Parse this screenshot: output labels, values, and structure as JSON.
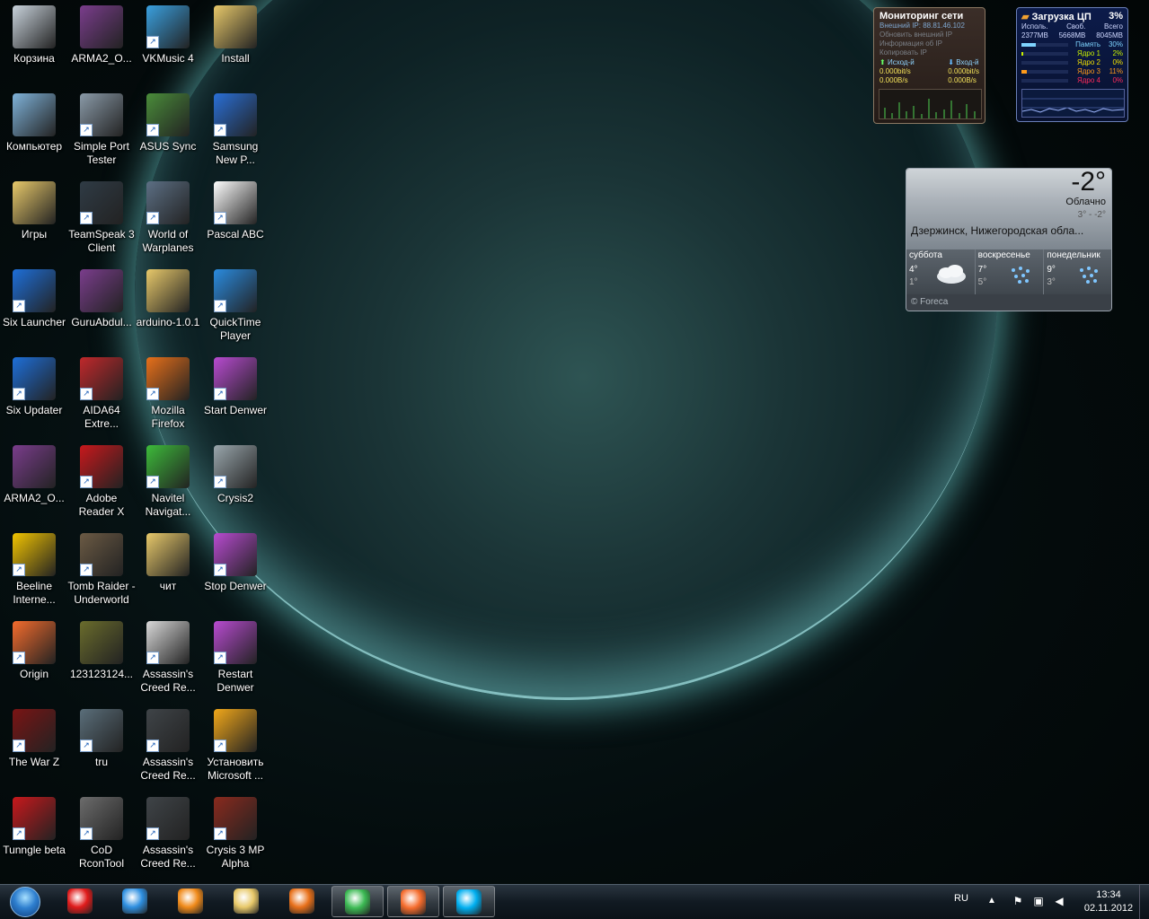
{
  "desktop": {
    "icons": [
      {
        "label": "Корзина",
        "icon": "recycle-bin-icon",
        "color": "#c9d3dc",
        "shortcut": false
      },
      {
        "label": "ARMA2_O...",
        "icon": "winrar-icon",
        "color": "#7a3d8c",
        "shortcut": false
      },
      {
        "label": "VKMusic 4",
        "icon": "vkmusic-icon",
        "color": "#3aa0e0",
        "shortcut": true
      },
      {
        "label": "Install",
        "icon": "folder-icon",
        "color": "#e8c96a",
        "shortcut": false
      },
      {
        "label": "Компьютер",
        "icon": "computer-icon",
        "color": "#7fb2d9",
        "shortcut": false
      },
      {
        "label": "Simple Port Tester",
        "icon": "port-tester-icon",
        "color": "#8a9aa8",
        "shortcut": true
      },
      {
        "label": "ASUS Sync",
        "icon": "asus-sync-icon",
        "color": "#4a8c3a",
        "shortcut": true
      },
      {
        "label": "Samsung New P...",
        "icon": "nps-icon",
        "color": "#2a6fd6",
        "shortcut": true
      },
      {
        "label": "Игры",
        "icon": "folder-icon",
        "color": "#e8c96a",
        "shortcut": false
      },
      {
        "label": "TeamSpeak 3 Client",
        "icon": "teamspeak-icon",
        "color": "#2f3b45",
        "shortcut": true
      },
      {
        "label": "World of Warplanes",
        "icon": "warplanes-icon",
        "color": "#5c6f84",
        "shortcut": true
      },
      {
        "label": "Pascal ABC",
        "icon": "pascal-abc-icon",
        "color": "#ffffff",
        "shortcut": true
      },
      {
        "label": "Six Launcher",
        "icon": "six-launcher-icon",
        "color": "#1e6fd9",
        "shortcut": true
      },
      {
        "label": "GuruAbdul...",
        "icon": "winrar-icon",
        "color": "#7a3d8c",
        "shortcut": false
      },
      {
        "label": "arduino-1.0.1",
        "icon": "folder-icon",
        "color": "#e8c96a",
        "shortcut": false
      },
      {
        "label": "QuickTime Player",
        "icon": "quicktime-icon",
        "color": "#2a8be0",
        "shortcut": true
      },
      {
        "label": "Six Updater",
        "icon": "six-updater-icon",
        "color": "#1e6fd9",
        "shortcut": true
      },
      {
        "label": "AIDA64 Extre...",
        "icon": "aida64-icon",
        "color": "#c0282b",
        "shortcut": true
      },
      {
        "label": "Mozilla Firefox",
        "icon": "firefox-icon",
        "color": "#e8701a",
        "shortcut": true
      },
      {
        "label": "Start Denwer",
        "icon": "denwer-start-icon",
        "color": "#b84bd1",
        "shortcut": true
      },
      {
        "label": "ARMA2_O...",
        "icon": "winrar-icon",
        "color": "#7a3d8c",
        "shortcut": false
      },
      {
        "label": "Adobe Reader X",
        "icon": "adobe-reader-icon",
        "color": "#c8181c",
        "shortcut": true
      },
      {
        "label": "Navitel Navigat...",
        "icon": "navitel-icon",
        "color": "#3dbb3a",
        "shortcut": true
      },
      {
        "label": "Crysis2",
        "icon": "crysis2-icon",
        "color": "#9aa7ad",
        "shortcut": true
      },
      {
        "label": "Beeline Interne...",
        "icon": "beeline-icon",
        "color": "#f2c400",
        "shortcut": true
      },
      {
        "label": "Tomb Raider - Underworld",
        "icon": "tomb-raider-icon",
        "color": "#6b5a44",
        "shortcut": true
      },
      {
        "label": "чит",
        "icon": "folder-icon",
        "color": "#e8c96a",
        "shortcut": false
      },
      {
        "label": "Stop Denwer",
        "icon": "denwer-stop-icon",
        "color": "#b84bd1",
        "shortcut": true
      },
      {
        "label": "Origin",
        "icon": "origin-icon",
        "color": "#f56c2d",
        "shortcut": true
      },
      {
        "label": "123123124...",
        "icon": "image-file-icon",
        "color": "#6a6c2c",
        "shortcut": false
      },
      {
        "label": "Assassin's Creed Re...",
        "icon": "assassins-creed-icon",
        "color": "#d9d9d9",
        "shortcut": true
      },
      {
        "label": "Restart Denwer",
        "icon": "denwer-restart-icon",
        "color": "#b84bd1",
        "shortcut": true
      },
      {
        "label": "The War Z",
        "icon": "warz-icon",
        "color": "#7a1414",
        "shortcut": true
      },
      {
        "label": "tru",
        "icon": "tomb-raider-icon",
        "color": "#5a6e7a",
        "shortcut": true
      },
      {
        "label": "Assassin's Creed Re...",
        "icon": "assassins-creed-icon",
        "color": "#3f4448",
        "shortcut": true
      },
      {
        "label": "Установить Microsoft ...",
        "icon": "ms-install-icon",
        "color": "#f2a81a",
        "shortcut": true
      },
      {
        "label": "Tunngle beta",
        "icon": "tunngle-icon",
        "color": "#c8181c",
        "shortcut": true
      },
      {
        "label": "CoD RconTool",
        "icon": "cod-rcon-icon",
        "color": "#6c6c6c",
        "shortcut": true
      },
      {
        "label": "Assassin's Creed Re...",
        "icon": "assassins-creed-icon",
        "color": "#3f4448",
        "shortcut": true
      },
      {
        "label": "Crysis 3 MP Alpha",
        "icon": "crysis3-icon",
        "color": "#8a2a1e",
        "shortcut": true
      }
    ]
  },
  "net_gadget": {
    "title": "Мониторинг сети",
    "ip_line": "Внешний IP: 88.81.46.102",
    "refresh": "Обновить внешний IP",
    "info": "Информация об IP",
    "copy": "Копировать IP",
    "out_label": "Исход-й",
    "in_label": "Вход-й",
    "out_bits": "0.000bit/s",
    "out_bytes": "0.000B/s",
    "in_bits": "0.000bit/s",
    "in_bytes": "0.000B/s"
  },
  "cpu_gadget": {
    "title": "Загрузка ЦП",
    "percent": "3%",
    "used_label": "Исполь.",
    "free_label": "Своб.",
    "total_label": "Всего",
    "used": "2377MB",
    "free": "5668MB",
    "total": "8045MB",
    "rows": [
      {
        "name": "Память",
        "value": "30%",
        "color": "#7fd4ff",
        "fill": 0.3
      },
      {
        "name": "Ядро 1",
        "value": "2%",
        "color": "#c8f000",
        "fill": 0.02
      },
      {
        "name": "Ядро 2",
        "value": "0%",
        "color": "#f0e000",
        "fill": 0.0
      },
      {
        "name": "Ядро 3",
        "value": "11%",
        "color": "#ff9a1a",
        "fill": 0.11
      },
      {
        "name": "Ядро 4",
        "value": "0%",
        "color": "#ff2a5a",
        "fill": 0.0
      }
    ]
  },
  "weather": {
    "temp": "-2°",
    "condition": "Облачно",
    "range": "3° - -2°",
    "city": "Дзержинск, Нижегородская обла...",
    "days": [
      {
        "name": "суббота",
        "hi": "4°",
        "lo": "1°",
        "icon": "cloud-icon"
      },
      {
        "name": "воскресенье",
        "hi": "7°",
        "lo": "5°",
        "icon": "rain-icon"
      },
      {
        "name": "понедельник",
        "hi": "9°",
        "lo": "3°",
        "icon": "rain-icon"
      }
    ],
    "source": "© Foreca"
  },
  "taskbar": {
    "apps": [
      {
        "name": "yandex-browser-icon",
        "color": "#e01b1b",
        "active": false
      },
      {
        "name": "internet-explorer-icon",
        "color": "#2e8fe0",
        "active": false
      },
      {
        "name": "media-player-icon",
        "color": "#f08a1a",
        "active": false
      },
      {
        "name": "explorer-icon",
        "color": "#e8c96a",
        "active": false
      },
      {
        "name": "firefox-icon",
        "color": "#e8701a",
        "active": false
      },
      {
        "name": "chrome-icon",
        "color": "#3cba54",
        "active": true
      },
      {
        "name": "origin-icon",
        "color": "#f56c2d",
        "active": true
      },
      {
        "name": "skype-icon",
        "color": "#00aff0",
        "active": true
      }
    ],
    "lang": "RU",
    "time": "13:34",
    "date": "02.11.2012"
  }
}
